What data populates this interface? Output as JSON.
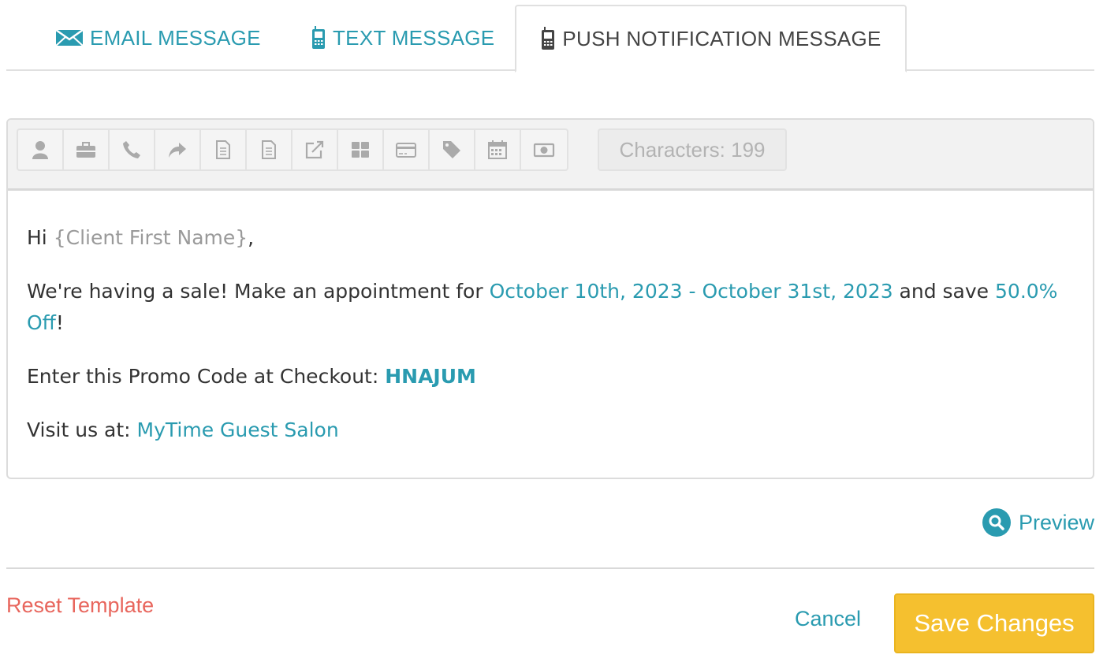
{
  "tabs": [
    {
      "label": "EMAIL MESSAGE",
      "icon": "envelope-icon"
    },
    {
      "label": "TEXT MESSAGE",
      "icon": "phone-icon"
    },
    {
      "label": "PUSH NOTIFICATION MESSAGE",
      "icon": "phone-icon",
      "active": true
    }
  ],
  "toolbar": {
    "buttons": [
      "person-icon",
      "briefcase-icon",
      "phone-icon",
      "share-icon",
      "document-icon",
      "document-icon",
      "external-link-icon",
      "grid-icon",
      "credit-card-icon",
      "tag-icon",
      "calendar-icon",
      "money-icon"
    ],
    "char_count": "Characters: 199"
  },
  "message": {
    "greeting_prefix": "Hi ",
    "client_var": "{Client First Name}",
    "greeting_suffix": ",",
    "line2_prefix": "We're having a sale! Make an appointment for ",
    "date_range": "October 10th, 2023 - October 31st, 2023",
    "line2_mid": " and save ",
    "discount": "50.0% Off",
    "line2_suffix": "!",
    "promo_prefix": "Enter this Promo Code at Checkout: ",
    "promo_code": "HNAJUM",
    "visit_prefix": "Visit us at: ",
    "salon_name": "MyTime Guest Salon"
  },
  "actions": {
    "preview": "Preview",
    "reset": "Reset Template",
    "cancel": "Cancel",
    "save": "Save Changes"
  },
  "colors": {
    "accent": "#2a9bb0",
    "reset": "#e8665d",
    "save_bg": "#f5c02f"
  }
}
